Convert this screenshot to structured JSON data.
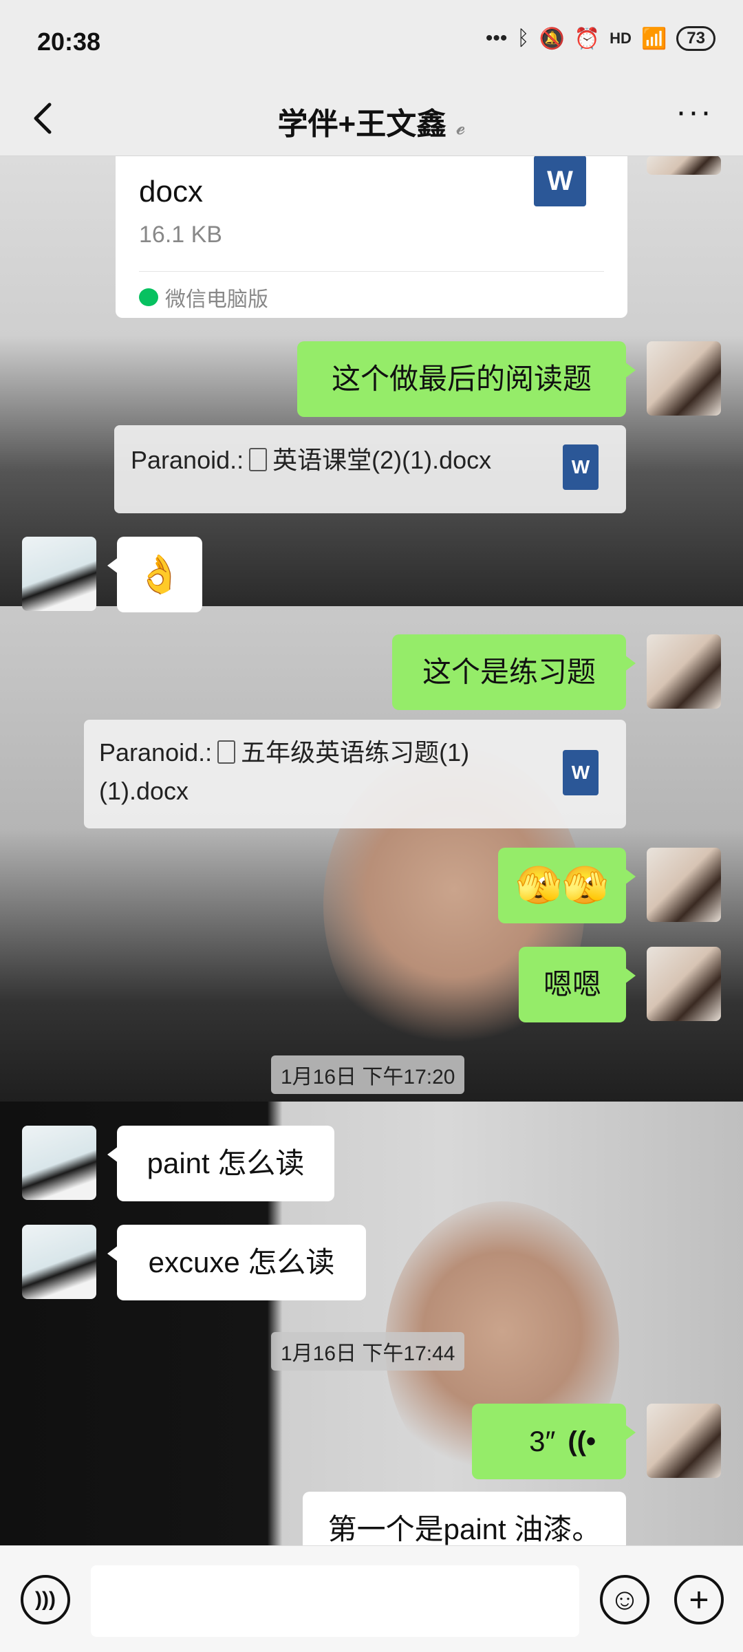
{
  "status": {
    "time": "20:38",
    "signal_label": "HD",
    "battery": "73"
  },
  "header": {
    "title": "学伴+王文鑫",
    "back_icon": "chevron-left-icon",
    "more_icon": "more-dots-icon"
  },
  "messages": {
    "file_card": {
      "name": "docx",
      "size": "16.1 KB",
      "source": "微信电脑版"
    },
    "m1": "这个做最后的阅读题",
    "q1": {
      "sender": "Paranoid.:",
      "file": "英语课堂(2)(1).docx"
    },
    "m2_emoji": "👌",
    "m3": "这个是练习题",
    "q2": {
      "sender": "Paranoid.:",
      "file": "五年级英语练习题(1)(1).docx"
    },
    "m4_emoji": "🫣🫣",
    "m5": "嗯嗯",
    "time1": "1月16日 下午17:20",
    "m6": "paint 怎么读",
    "m7": "excuxe 怎么读",
    "time2": "1月16日 下午17:44",
    "voice_duration": "3″",
    "m8": "第一个是paint 油漆。"
  },
  "input_bar": {
    "placeholder": "",
    "voice_icon": "voice-icon",
    "emoji_icon": "emoji-icon",
    "plus_icon": "plus-icon"
  }
}
